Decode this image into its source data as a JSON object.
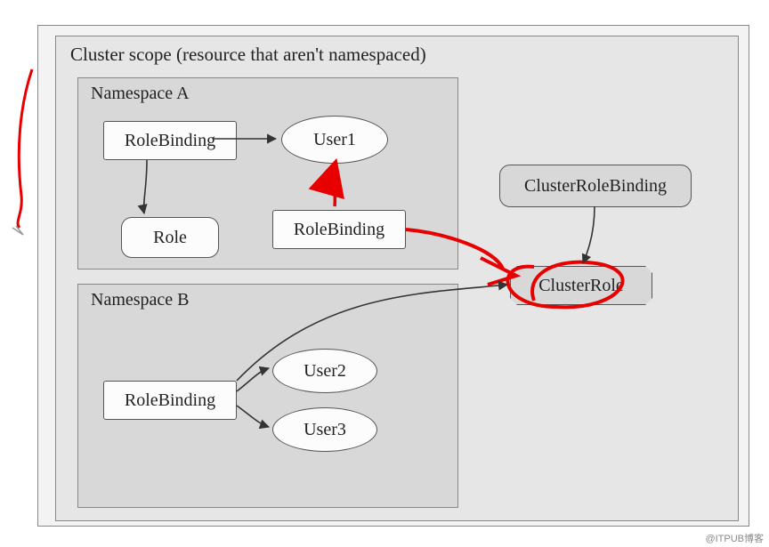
{
  "cluster": {
    "title": "Cluster scope (resource that aren't namespaced)"
  },
  "namespaceA": {
    "title": "Namespace A",
    "roleBinding1": "RoleBinding",
    "role": "Role",
    "user1": "User1",
    "roleBinding2": "RoleBinding"
  },
  "namespaceB": {
    "title": "Namespace B",
    "roleBinding": "RoleBinding",
    "user2": "User2",
    "user3": "User3"
  },
  "clusterRoleBinding": "ClusterRoleBinding",
  "clusterRole": "ClusterRole",
  "watermark": "@ITPUB博客"
}
